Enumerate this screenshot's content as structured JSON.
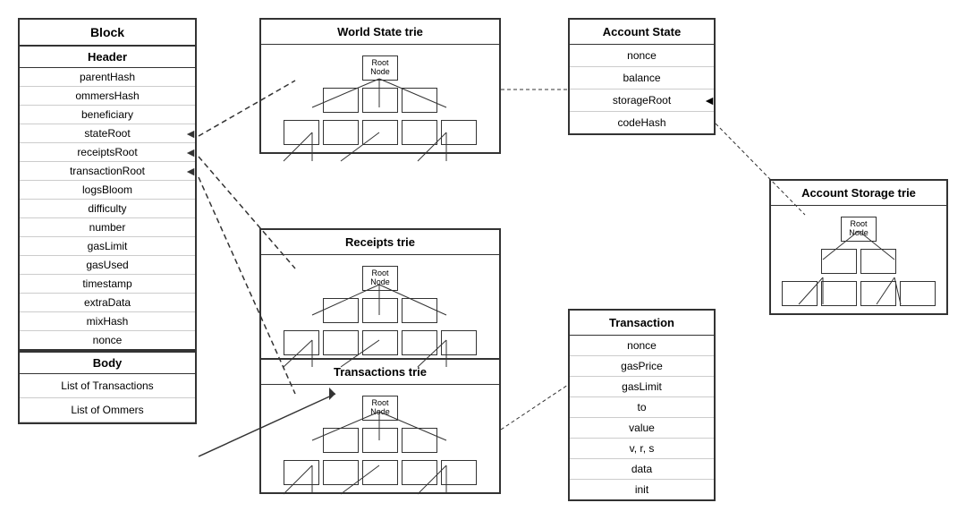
{
  "block": {
    "title": "Block",
    "header": {
      "title": "Header",
      "fields": [
        {
          "label": "parentHash",
          "hasArrow": false
        },
        {
          "label": "ommersHash",
          "hasArrow": false
        },
        {
          "label": "beneficiary",
          "hasArrow": false
        },
        {
          "label": "stateRoot",
          "hasArrow": true
        },
        {
          "label": "receiptsRoot",
          "hasArrow": true
        },
        {
          "label": "transactionRoot",
          "hasArrow": true
        },
        {
          "label": "logsBloom",
          "hasArrow": false
        },
        {
          "label": "difficulty",
          "hasArrow": false
        },
        {
          "label": "number",
          "hasArrow": false
        },
        {
          "label": "gasLimit",
          "hasArrow": false
        },
        {
          "label": "gasUsed",
          "hasArrow": false
        },
        {
          "label": "timestamp",
          "hasArrow": false
        },
        {
          "label": "extraData",
          "hasArrow": false
        },
        {
          "label": "mixHash",
          "hasArrow": false
        },
        {
          "label": "nonce",
          "hasArrow": false
        }
      ]
    },
    "body": {
      "title": "Body",
      "fields": [
        {
          "label": "List of Transactions",
          "hasArrow": true
        },
        {
          "label": "List of Ommers",
          "hasArrow": false
        }
      ]
    }
  },
  "worldStateTrie": {
    "title": "World State trie",
    "rootLabel": "Root\nNode"
  },
  "receiptsTrie": {
    "title": "Receipts trie",
    "rootLabel": "Root\nNode"
  },
  "transactionsTrie": {
    "title": "Transactions trie",
    "rootLabel": "Root\nNode"
  },
  "accountState": {
    "title": "Account State",
    "fields": [
      "nonce",
      "balance",
      "storageRoot",
      "codeHash"
    ]
  },
  "accountStorageTrie": {
    "title": "Account Storage trie",
    "rootLabel": "Root\nNode"
  },
  "transaction": {
    "title": "Transaction",
    "fields": [
      "nonce",
      "gasPrice",
      "gasLimit",
      "to",
      "value",
      "v, r, s",
      "data",
      "init"
    ]
  }
}
